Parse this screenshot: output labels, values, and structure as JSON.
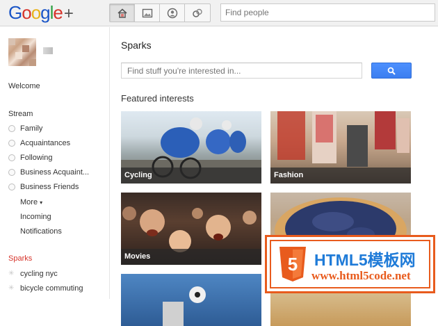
{
  "app": {
    "logo": "Google+"
  },
  "topbar": {
    "nav_icons": [
      "home-icon",
      "photos-icon",
      "profile-icon",
      "circles-icon"
    ],
    "find_people_placeholder": "Find people"
  },
  "sidebar": {
    "welcome": "Welcome",
    "stream_label": "Stream",
    "stream_items": [
      "Family",
      "Acquaintances",
      "Following",
      "Business Acquaint...",
      "Business Friends"
    ],
    "more": "More",
    "incoming": "Incoming",
    "notifications": "Notifications",
    "sparks_label": "Sparks",
    "spark_items": [
      "cycling nyc",
      "bicycle commuting"
    ]
  },
  "main": {
    "title": "Sparks",
    "search_placeholder": "Find stuff you're interested in...",
    "featured_label": "Featured interests",
    "tiles": [
      {
        "caption": "Cycling"
      },
      {
        "caption": "Fashion"
      },
      {
        "caption": "Movies"
      }
    ]
  },
  "watermark": {
    "title": "HTML5模板网",
    "url": "www.html5code.net",
    "badge": "5"
  },
  "colors": {
    "accent_blue": "#4d90fe",
    "sparks_red": "#d6332a",
    "watermark_orange": "#e85b1d"
  }
}
